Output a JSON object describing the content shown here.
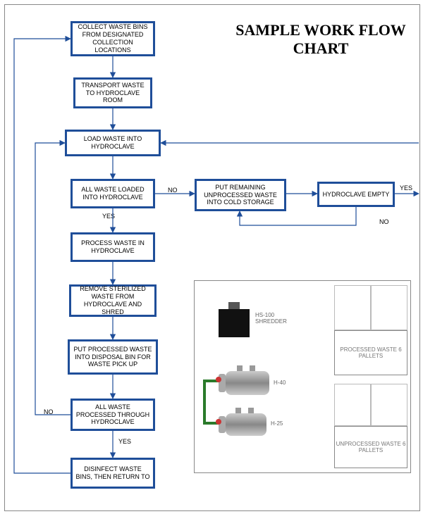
{
  "title_line1": "SAMPLE WORK FLOW",
  "title_line2": "CHART",
  "nodes": {
    "collect": "COLLECT WASTE BINS FROM DESIGNATED COLLECTION LOCATIONS",
    "transport": "TRANSPORT WASTE TO HYDROCLAVE ROOM",
    "load": "LOAD WASTE INTO HYDROCLAVE",
    "all_loaded": "ALL WASTE LOADED INTO HYDROCLAVE",
    "cold": "PUT REMAINING UNPROCESSED WASTE INTO COLD STORAGE",
    "empty": "HYDROCLAVE EMPTY",
    "process": "PROCESS WASTE IN HYDROCLAVE",
    "remove": "REMOVE STERILIZED WASTE FROM HYDROCLAVE AND SHRED",
    "disposal": "PUT PROCESSED WASTE INTO DISPOSAL BIN FOR WASTE PICK UP",
    "all_proc": "ALL WASTE PROCESSED THROUGH HYDROCLAVE",
    "disinfect": "DISINFECT WASTE BINS, THEN RETURN TO"
  },
  "labels": {
    "yes": "YES",
    "no": "NO"
  },
  "machines": {
    "shredder": "HS-100 SHREDDER",
    "h40": "H-40",
    "h25": "H-25",
    "processed": "PROCESSED WASTE 6 PALLETS",
    "unprocessed": "UNPROCESSED WASTE 6 PALLETS"
  }
}
